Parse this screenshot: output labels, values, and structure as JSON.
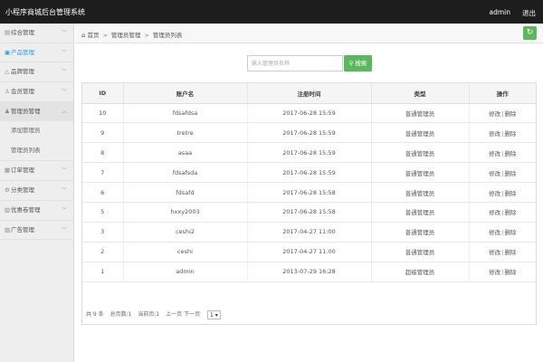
{
  "app": {
    "title": "小程序商城后台管理系统"
  },
  "header": {
    "user": "admin",
    "logout": "退出"
  },
  "sidebar": {
    "items": [
      {
        "label": "综合管理",
        "icon": "grid-icon",
        "glyph": "▤",
        "open": false
      },
      {
        "label": "产品管理",
        "icon": "product-icon",
        "glyph": "▣",
        "open": false,
        "active": true
      },
      {
        "label": "品牌管理",
        "icon": "brand-icon",
        "glyph": "△",
        "open": false
      },
      {
        "label": "会员管理",
        "icon": "user-icon",
        "glyph": "♙",
        "open": false
      },
      {
        "label": "管理员管理",
        "icon": "admin-icon",
        "glyph": "♟",
        "open": true,
        "children": [
          {
            "label": "添加管理员"
          },
          {
            "label": "管理员列表"
          }
        ]
      },
      {
        "label": "订单管理",
        "icon": "order-icon",
        "glyph": "▦",
        "open": false
      },
      {
        "label": "分类管理",
        "icon": "category-icon",
        "glyph": "⚙",
        "open": false
      },
      {
        "label": "优惠卷管理",
        "icon": "coupon-icon",
        "glyph": "▥",
        "open": false
      },
      {
        "label": "广告管理",
        "icon": "ad-icon",
        "glyph": "▧",
        "open": false
      }
    ]
  },
  "breadcrumb": {
    "home": "首页",
    "level1": "管理员管理",
    "level2": "管理员列表"
  },
  "search": {
    "placeholder": "输入管理员名称",
    "button": "搜索"
  },
  "table": {
    "headers": [
      "ID",
      "账户名",
      "注册时间",
      "类型",
      "操作"
    ],
    "rows": [
      {
        "id": "10",
        "name": "fdsafdsa",
        "time": "2017-06-28 15:59",
        "type": "普通管理员"
      },
      {
        "id": "9",
        "name": "tretre",
        "time": "2017-06-28 15:59",
        "type": "普通管理员"
      },
      {
        "id": "8",
        "name": "asaa",
        "time": "2017-06-28 15:59",
        "type": "普通管理员"
      },
      {
        "id": "7",
        "name": "fdsafsda",
        "time": "2017-06-28 15:59",
        "type": "普通管理员"
      },
      {
        "id": "6",
        "name": "fdsafd",
        "time": "2017-06-28 15:58",
        "type": "普通管理员"
      },
      {
        "id": "5",
        "name": "hxxy2003",
        "time": "2017-06-28 15:58",
        "type": "普通管理员"
      },
      {
        "id": "3",
        "name": "ceshi2",
        "time": "2017-04-27 11:00",
        "type": "普通管理员"
      },
      {
        "id": "2",
        "name": "ceshi",
        "time": "2017-04-27 11:00",
        "type": "普通管理员"
      },
      {
        "id": "1",
        "name": "admin",
        "time": "2013-07-29 16:28",
        "type": "超级管理员"
      }
    ],
    "edit_label": "修改",
    "delete_label": "删除"
  },
  "pager": {
    "total": "共 9 条",
    "pages": "总页数:1",
    "current": "当前页:1",
    "prev": "上一页",
    "next": "下一页",
    "select_value": "1 ▾"
  },
  "colors": {
    "topbar": "#1d1d1d",
    "accent_green": "#5cb85c",
    "active_blue": "#2a9fd6"
  }
}
